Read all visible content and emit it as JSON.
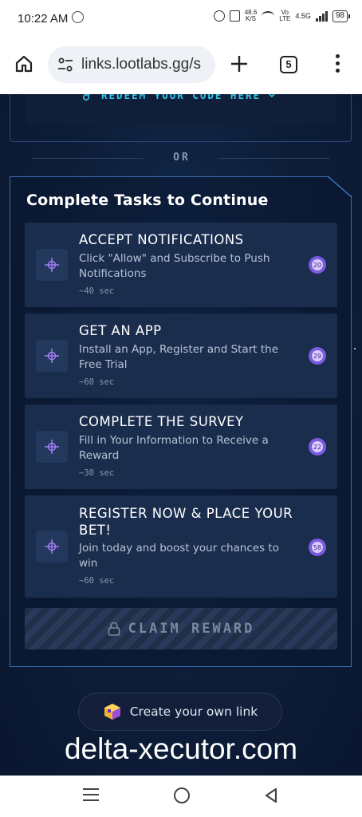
{
  "status_bar": {
    "time": "10:22 AM",
    "net_speed_value": "48.6",
    "net_speed_unit": "K/S",
    "volte_top": "Vo",
    "volte_bottom": "LTE",
    "network_type": "4.5G",
    "battery": "98"
  },
  "browser": {
    "url": "links.lootlabs.gg/s",
    "tab_count": "5"
  },
  "redeem": {
    "label": "REDEEM YOUR CODE HERE"
  },
  "divider": {
    "text": "OR"
  },
  "tasks": {
    "title": "Complete Tasks to Continue",
    "items": [
      {
        "title": "ACCEPT NOTIFICATIONS",
        "description": "Click \"Allow\" and Subscribe to Push Notifications",
        "time": "~40 sec",
        "timer": "20"
      },
      {
        "title": "GET AN APP",
        "description": "Install an App, Register and Start the Free Trial",
        "time": "~60 sec",
        "timer": "29"
      },
      {
        "title": "COMPLETE THE SURVEY",
        "description": "Fill in Your Information to Receive a Reward",
        "time": "~30 sec",
        "timer": "22"
      },
      {
        "title": "REGISTER NOW & PLACE YOUR BET!",
        "description": "Join today and boost your chances to win",
        "time": "~60 sec",
        "timer": "58"
      }
    ],
    "claim_label": "CLAIM REWARD"
  },
  "create_link": {
    "label": "Create your own link"
  },
  "watermark": {
    "text": "delta-xecutor.com"
  },
  "colors": {
    "accent_cyan": "#35c4e6",
    "task_icon": "#a57bf5",
    "card_border": "#3a6fb0",
    "page_bg": "#0d1d38"
  }
}
